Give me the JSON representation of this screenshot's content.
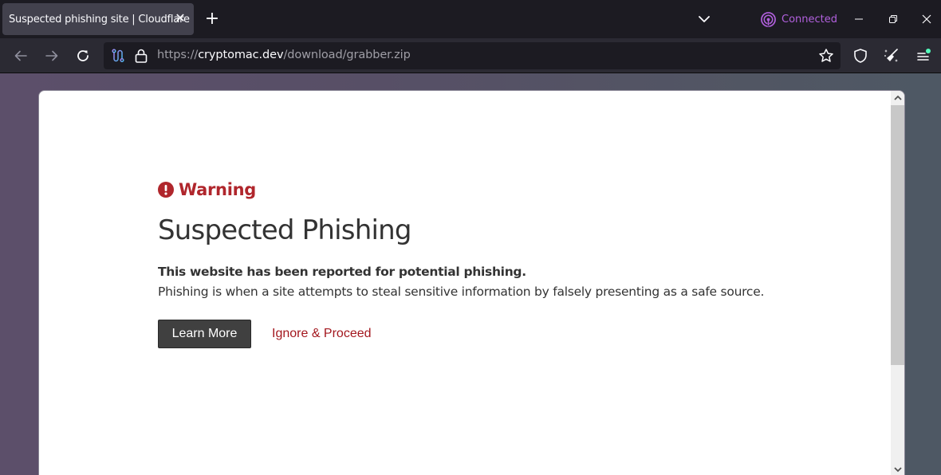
{
  "browser": {
    "tab": {
      "title": "Suspected phishing site | Cloudflare",
      "close_glyph": "✕"
    },
    "new_tab_glyph": "+",
    "vpn": {
      "label": "Connected",
      "color": "#b160dd"
    },
    "url": {
      "scheme": "https://",
      "host": "cryptomac.dev",
      "path": "/download/grabber.zip"
    },
    "icons": {
      "back": "arrow-left-icon",
      "forward": "arrow-right-icon",
      "reload": "reload-icon",
      "permissions": "permissions-icon",
      "lock": "lock-icon",
      "bookmark": "star-icon",
      "shield": "shield-icon",
      "cleaner": "broom-sparkle-icon",
      "menu": "hamburger-menu-icon",
      "tab_list": "chevron-down-icon",
      "minimize": "minimize-icon",
      "restore": "restore-icon",
      "close": "close-icon"
    },
    "menu_badge_color": "#54ffbd"
  },
  "page": {
    "warning": {
      "label": "Warning",
      "icon": "exclamation-circle-icon",
      "color": "#b0262c"
    },
    "title": "Suspected Phishing",
    "lead": "This website has been reported for potential phishing.",
    "description": "Phishing is when a site attempts to steal sensitive information by falsely presenting as a safe source.",
    "actions": {
      "learn_more": "Learn More",
      "ignore": "Ignore & Proceed"
    }
  }
}
